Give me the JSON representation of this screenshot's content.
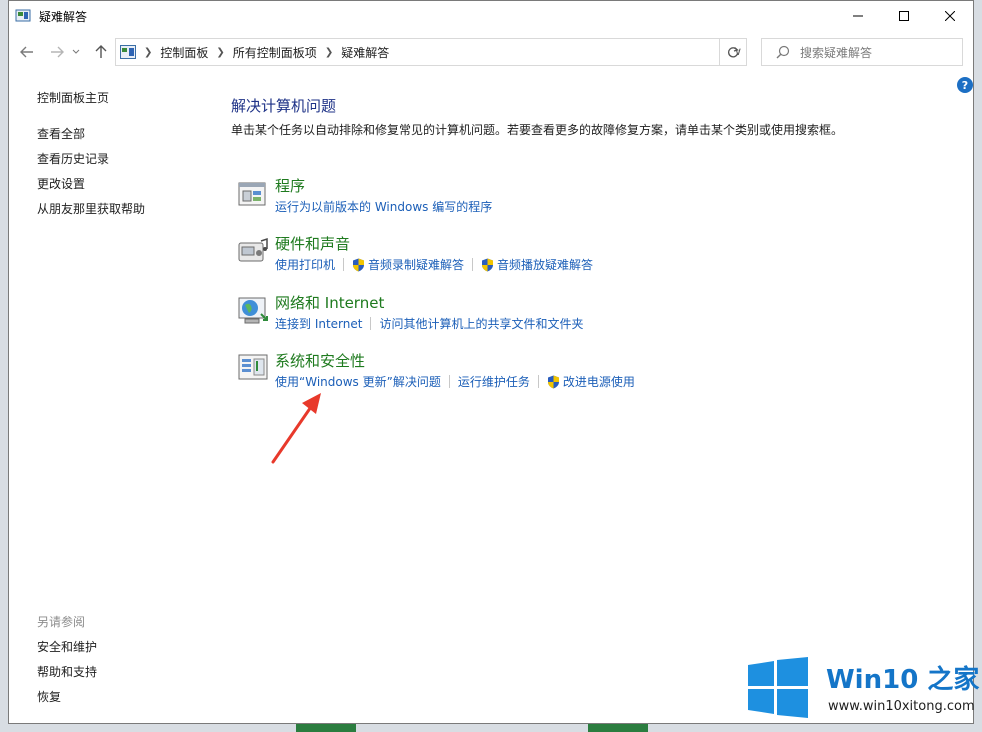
{
  "window": {
    "title": "疑难解答"
  },
  "address": {
    "crumbs": [
      "控制面板",
      "所有控制面板项",
      "疑难解答"
    ]
  },
  "search": {
    "placeholder": "搜索疑难解答"
  },
  "sidebar": {
    "home": "控制面板主页",
    "items": [
      "查看全部",
      "查看历史记录",
      "更改设置",
      "从朋友那里获取帮助"
    ],
    "see_also_heading": "另请参阅",
    "see_also": [
      "安全和维护",
      "帮助和支持",
      "恢复"
    ]
  },
  "main": {
    "title": "解决计算机问题",
    "description": "单击某个任务以自动排除和修复常见的计算机问题。若要查看更多的故障修复方案，请单击某个类别或使用搜索框。",
    "categories": [
      {
        "title": "程序",
        "icon": "programs-icon",
        "links": [
          {
            "label": "运行为以前版本的 Windows 编写的程序",
            "shield": false
          }
        ]
      },
      {
        "title": "硬件和声音",
        "icon": "hardware-sound-icon",
        "links": [
          {
            "label": "使用打印机",
            "shield": false
          },
          {
            "label": "音频录制疑难解答",
            "shield": true
          },
          {
            "label": "音频播放疑难解答",
            "shield": true
          }
        ]
      },
      {
        "title": "网络和 Internet",
        "icon": "network-icon",
        "links": [
          {
            "label": "连接到 Internet",
            "shield": false
          },
          {
            "label": "访问其他计算机上的共享文件和文件夹",
            "shield": false
          }
        ]
      },
      {
        "title": "系统和安全性",
        "icon": "system-security-icon",
        "links": [
          {
            "label": "使用“Windows 更新”解决问题",
            "shield": false
          },
          {
            "label": "运行维护任务",
            "shield": false
          },
          {
            "label": "改进电源使用",
            "shield": true
          }
        ]
      }
    ]
  },
  "watermark": {
    "brand": "Win10 之家",
    "url": "www.win10xitong.com"
  },
  "colors": {
    "link": "#1c5fb8",
    "category_title": "#1e7a1e",
    "page_title": "#1e3287",
    "arrow": "#e8392b",
    "brand": "#1475c8"
  }
}
